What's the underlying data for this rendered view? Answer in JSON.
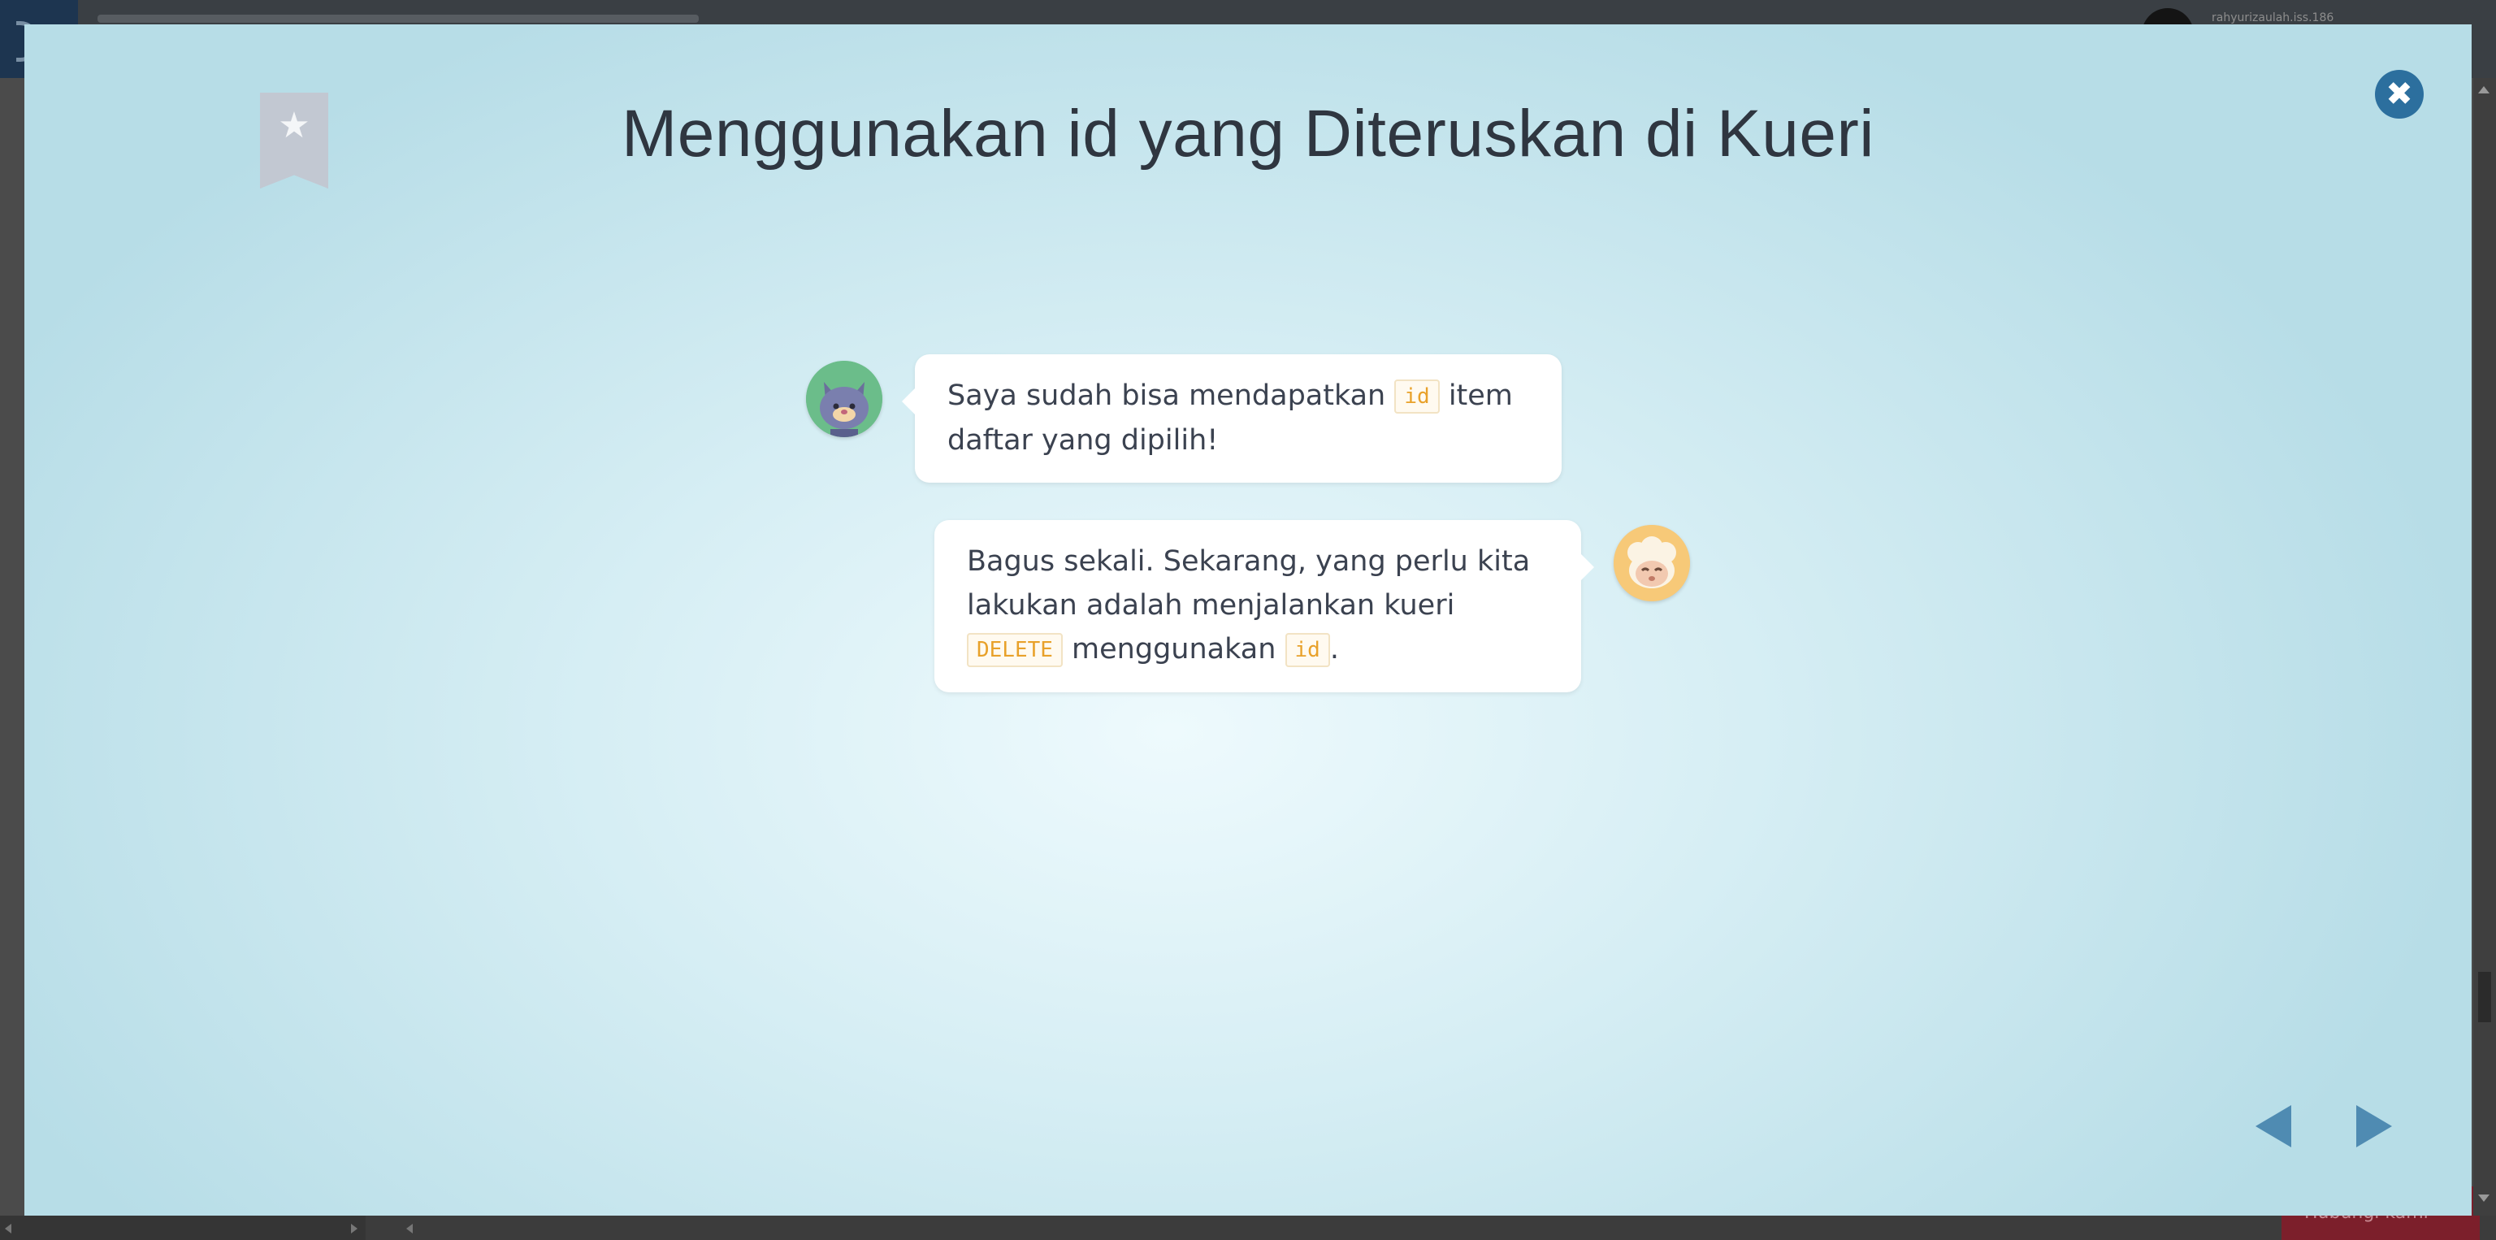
{
  "background": {
    "username": "rahyurizaulah.iss.186",
    "hint_button": "Hubungi kami"
  },
  "modal": {
    "title": "Menggunakan id yang Diteruskan di Kueri",
    "bookmark_icon": "star-icon",
    "close_icon": "close-icon"
  },
  "chat": [
    {
      "speaker": "cat",
      "text_before": "Saya sudah bisa mendapatkan ",
      "code_1": "id",
      "text_after": " item daftar yang dipilih!"
    },
    {
      "speaker": "sheep",
      "text_before": "Bagus sekali. Sekarang, yang perlu kita lakukan adalah menjalankan kueri ",
      "code_1": "DELETE",
      "text_middle": " menggunakan ",
      "code_2": "id",
      "text_after": "."
    }
  ],
  "navigation": {
    "prev_icon": "triangle-left-icon",
    "next_icon": "triangle-right-icon"
  },
  "colors": {
    "modal_bg_center": "#eefafd",
    "modal_bg_edge": "#b7dde7",
    "accent_blue": "#2c6f9e",
    "nav_arrow": "#4f8bb2",
    "code_text": "#e8a12a"
  }
}
